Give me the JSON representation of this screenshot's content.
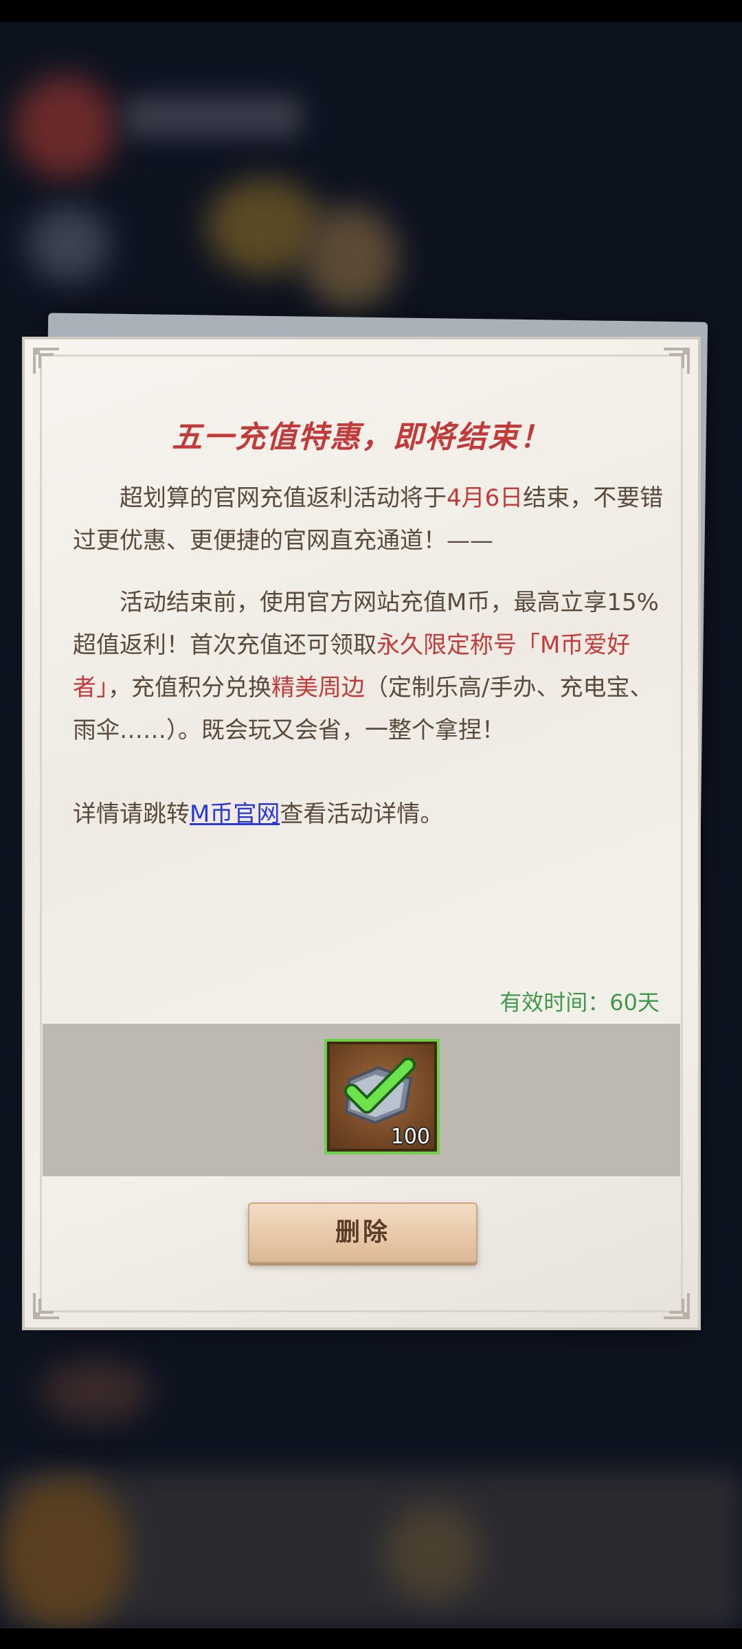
{
  "mail": {
    "title": "五一充值特惠，即将结束！",
    "p1": {
      "part1": "超划算的官网充值返利活动将于",
      "date": "4月6日",
      "part2": "结束，不要错过更优惠、更便捷的官网直充通道！——"
    },
    "p2": {
      "part1": "活动结束前，使用官方网站充值M币，最高立享15%超值返利！首次充值还可领取",
      "title_highlight": "永久限定称号「M币爱好者」",
      "part2": "，充值积分兑换",
      "merch_highlight": "精美周边",
      "part3": "（定制乐高/手办、充电宝、雨伞……）。既会玩又会省，一整个拿捏！"
    },
    "p3": {
      "part1": "详情请跳转",
      "link": "M币官网",
      "part2": "查看活动详情。"
    },
    "validity": "有效时间：60天"
  },
  "attachment": {
    "icon": "green-checkmark-badge-icon",
    "count": "100",
    "border_color": "#6ed04a"
  },
  "actions": {
    "delete_label": "删除"
  },
  "colors": {
    "title_red": "#c23a3a",
    "link_blue": "#2a38d8",
    "validity_green": "#3d9a4b",
    "body_text": "#5a4a3c"
  }
}
